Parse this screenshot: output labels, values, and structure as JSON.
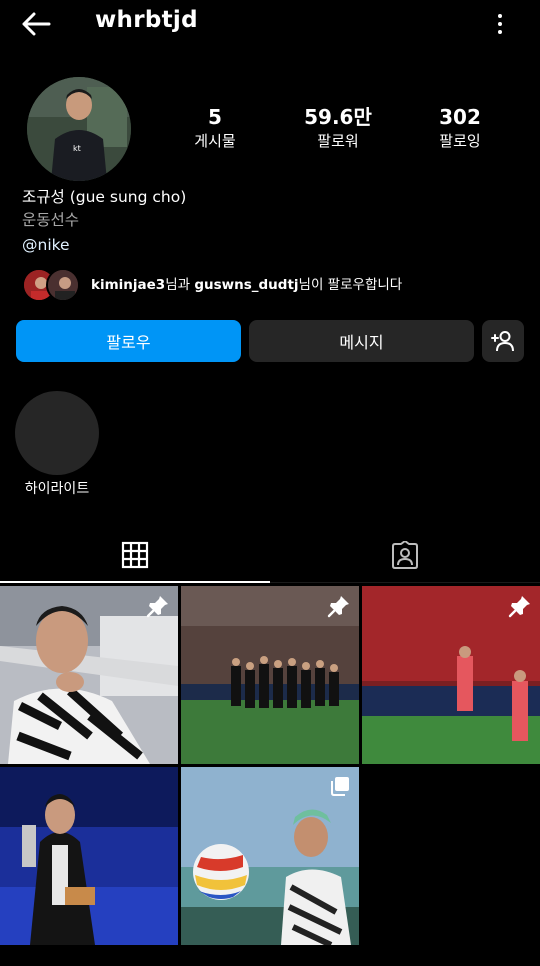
{
  "header": {
    "username": "whrbtjd"
  },
  "profile": {
    "posts_count": "5",
    "posts_label": "게시물",
    "followers_count": "59.6만",
    "followers_label": "팔로워",
    "following_count": "302",
    "following_label": "팔로잉",
    "full_name": "조규성 (gue sung cho)",
    "category": "운동선수",
    "link": "@nike"
  },
  "mutuals": {
    "user1": "kiminjae3",
    "connector1": "님과 ",
    "user2": "guswns_dudtj",
    "suffix": "님이 팔로우합니다"
  },
  "actions": {
    "follow_label": "팔로우",
    "message_label": "메시지"
  },
  "highlights": [
    {
      "label": "하이라이트"
    }
  ],
  "tabs": {
    "active": "grid",
    "icons": [
      "grid-icon",
      "tagged-person-icon"
    ]
  },
  "posts": [
    {
      "pinned": true,
      "multi": false
    },
    {
      "pinned": true,
      "multi": false
    },
    {
      "pinned": true,
      "multi": false
    },
    {
      "pinned": false,
      "multi": false
    },
    {
      "pinned": false,
      "multi": true
    }
  ],
  "colors": {
    "background": "#000000",
    "follow_button": "#0095f6",
    "secondary_button": "#262626",
    "muted_text": "#a8a8a8"
  }
}
